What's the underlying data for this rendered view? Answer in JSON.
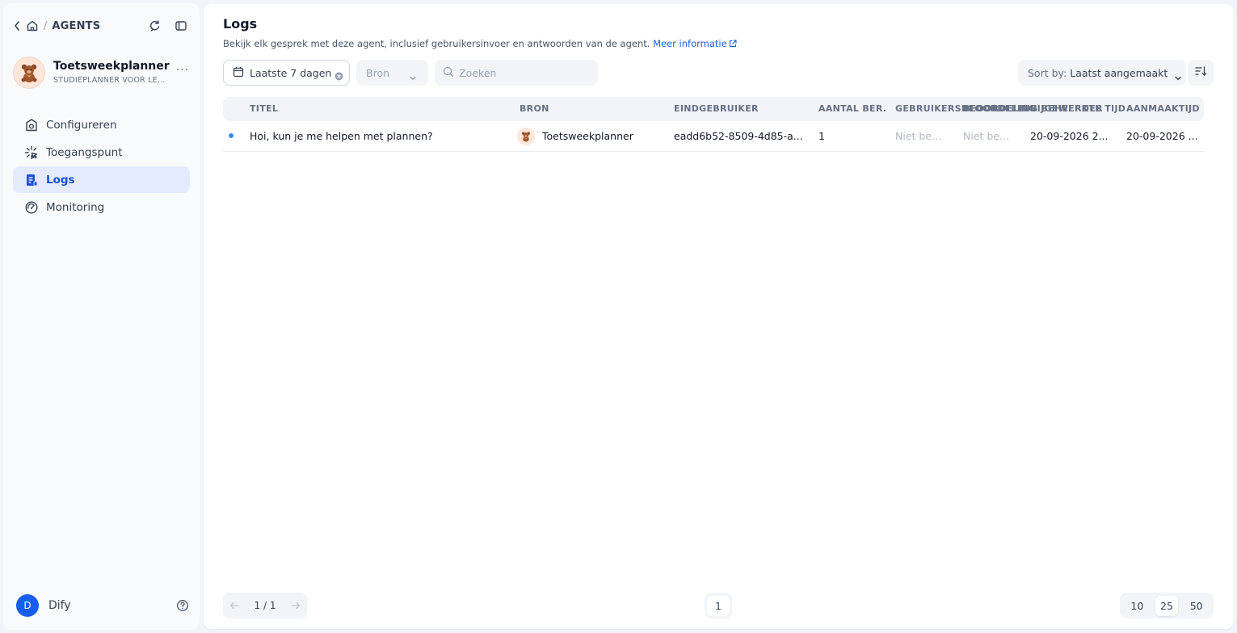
{
  "breadcrumb": {
    "section": "AGENTS"
  },
  "app": {
    "name": "Toetsweekplanner",
    "subtitle": "STUDIEPLANNER VOOR LEERLINGEN",
    "more": "···"
  },
  "nav": [
    {
      "label": "Configureren",
      "icon": "configure-icon",
      "active": false
    },
    {
      "label": "Toegangspunt",
      "icon": "access-point-icon",
      "active": false
    },
    {
      "label": "Logs",
      "icon": "logs-icon",
      "active": true
    },
    {
      "label": "Monitoring",
      "icon": "monitoring-icon",
      "active": false
    }
  ],
  "user": {
    "initial": "D",
    "name": "Dify"
  },
  "page": {
    "title": "Logs",
    "description": "Bekijk elk gesprek met deze agent, inclusief gebruikersinvoer en antwoorden van de agent.",
    "more_info": "Meer informatie"
  },
  "filters": {
    "date_range": "Laatste 7 dagen",
    "source_placeholder": "Bron",
    "search_placeholder": "Zoeken",
    "sort_label": "Sort by:",
    "sort_value": "Laatst aangemaakt"
  },
  "table": {
    "headers": {
      "title": "TITEL",
      "source": "BRON",
      "end_user": "EINDGEBRUIKER",
      "message_count": "AANTAL BER.",
      "user_rating": "GEBRUIKERSBEOORDELING",
      "admin_rating": "BEOORDELING BEHEERDER",
      "updated": "BIJGEWERKTE TIJD",
      "created": "AANMAAKTIJD"
    },
    "rows": [
      {
        "title": "Hoi, kun je me helpen met plannen?",
        "source": "Toetsweekplanner",
        "end_user": "eadd6b52-8509-4d85-a...",
        "message_count": "1",
        "user_rating": "Niet be...",
        "admin_rating": "Niet be...",
        "updated": "20-09-2026 2...",
        "created": "20-09-2026 ..."
      }
    ]
  },
  "pagination": {
    "indicator": "1 / 1",
    "current_page": "1",
    "page_sizes": [
      "10",
      "25",
      "50"
    ],
    "selected_size": "25"
  },
  "colors": {
    "accent": "#155eef",
    "active_bg": "#e4ebff",
    "active_text": "#1d4ed8",
    "dot": "#2e90fa"
  }
}
